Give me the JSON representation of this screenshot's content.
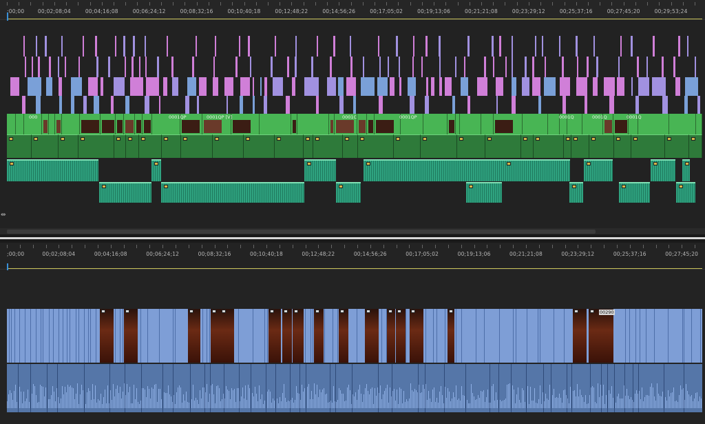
{
  "top_timeline": {
    "timecodes": [
      ";00;00",
      "00;02;08;04",
      "00;04;16;08",
      "00;06;24;12",
      "00;08;32;16",
      "00;10;40;18",
      "00;12;48;22",
      "00;14;56;26",
      "00;17;05;02",
      "00;19;13;06",
      "00;21;21;08",
      "00;23;29;12",
      "00;25;37;16",
      "00;27;45;20",
      "00;29;53;24"
    ],
    "clip_labels": [
      "000",
      "0001QP",
      "0001QP [V]",
      "0001C",
      "0001QP",
      "0001Q",
      "0001Q",
      "0001Q"
    ]
  },
  "bottom_timeline": {
    "timecodes": [
      ";00;00",
      "00;02;08;04",
      "00;04;16;08",
      "00;06;24;12",
      "00;08;32;16",
      "00;10;40;18",
      "00;12;48;22",
      "00;14;56;26",
      "00;17;05;02",
      "00;19;13;06",
      "00;21;21;08",
      "00;23;29;12",
      "00;25;37;16",
      "00;27;45;20"
    ],
    "clip_label": "00290"
  },
  "colors": {
    "pink": "#d07fd8",
    "lavender": "#a191e0",
    "steel_blue": "#7aa0d8",
    "green_video": "#48b554",
    "green_audio": "#2e7a3a",
    "teal_audio": "#2fa380",
    "bottom_video": "#7e9ed6",
    "bottom_audio": "#5576a8"
  }
}
